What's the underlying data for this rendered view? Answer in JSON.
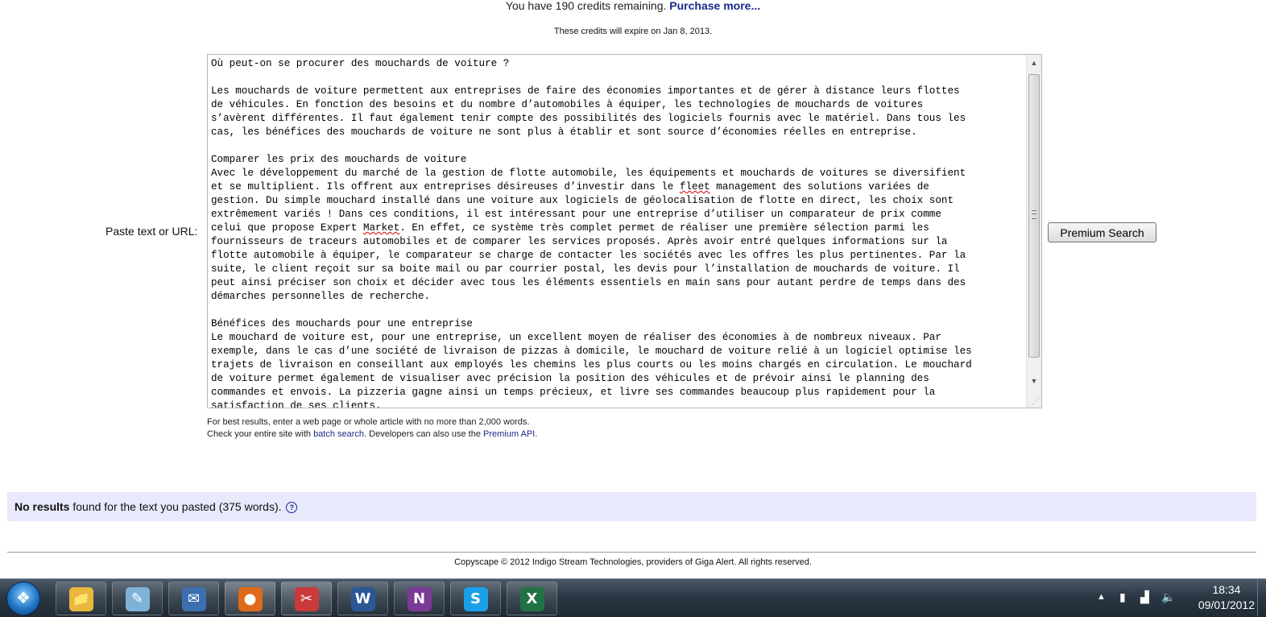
{
  "credits": {
    "prefix": "You have 190 credits remaining.",
    "purchase_link": "Purchase more...",
    "expiry": "These credits will expire on Jan 8, 2013."
  },
  "search": {
    "label": "Paste text or URL:",
    "button_label": "Premium Search",
    "text_lines": [
      "Où peut-on se procurer des mouchards de voiture ?",
      "",
      "Les mouchards de voiture permettent aux entreprises de faire des économies importantes et de gérer à distance leurs flottes",
      "de véhicules. En fonction des besoins et du nombre d’automobiles à équiper, les technologies de mouchards de voitures",
      "s’avèrent différentes. Il faut également tenir compte des possibilités des logiciels fournis avec le matériel. Dans tous les",
      "cas, les bénéfices des mouchards de voiture ne sont plus à établir et sont source d’économies réelles en entreprise.",
      "",
      "Comparer les prix des mouchards de voiture",
      "Avec le développement du marché de la gestion de flotte automobile, les équipements et mouchards de voitures se diversifient",
      "et se multiplient. Ils offrent aux entreprises désireuses d’investir dans le fleet management des solutions variées de",
      "gestion. Du simple mouchard installé dans une voiture aux logiciels de géolocalisation de flotte en direct, les choix sont",
      "extrêmement variés ! Dans ces conditions, il est intéressant pour une entreprise d’utiliser un comparateur de prix comme",
      "celui que propose Expert Market. En effet, ce système très complet permet de réaliser une première sélection parmi les",
      "fournisseurs de traceurs automobiles et de comparer les services proposés. Après avoir entré quelques informations sur la",
      "flotte automobile à équiper, le comparateur se charge de contacter les sociétés avec les offres les plus pertinentes. Par la",
      "suite, le client reçoit sur sa boite mail ou par courrier postal, les devis pour l’installation de mouchards de voiture. Il",
      "peut ainsi préciser son choix et décider avec tous les éléments essentiels en main sans pour autant perdre de temps dans des",
      "démarches personnelles de recherche.",
      "",
      "Bénéfices des mouchards pour une entreprise",
      "Le mouchard de voiture est, pour une entreprise, un excellent moyen de réaliser des économies à de nombreux niveaux. Par",
      "exemple, dans le cas d’une société de livraison de pizzas à domicile, le mouchard de voiture relié à un logiciel optimise les",
      "trajets de livraison en conseillant aux employés les chemins les plus courts ou les moins chargés en circulation. Le mouchard",
      "de voiture permet également de visualiser avec précision la position des véhicules et de prévoir ainsi le planning des",
      "commandes et envois. La pizzeria gagne ainsi un temps précieux, et livre ses commandes beaucoup plus rapidement pour la",
      "satisfaction de ses clients."
    ]
  },
  "hint": {
    "line1": "For best results, enter a web page or whole article with no more than 2,000 words.",
    "line2_a": "Check your entire site with ",
    "batch_link": "batch search",
    "line2_b": ". Developers can also use the ",
    "api_link": "Premium API",
    "line2_c": "."
  },
  "results": {
    "bold": "No results",
    "rest": " found for the text you pasted (375 words).",
    "help_icon": "?"
  },
  "footer": "Copyscape © 2012 Indigo Stream Technologies, providers of Giga Alert. All rights reserved.",
  "taskbar": {
    "apps": [
      {
        "name": "windows-explorer",
        "glyph": "📁",
        "color": "#e8b93c"
      },
      {
        "name": "notepad",
        "glyph": "✎",
        "color": "#7fb2d8"
      },
      {
        "name": "thunderbird",
        "glyph": "✉",
        "color": "#3d6fb0"
      },
      {
        "name": "firefox",
        "glyph": "●",
        "color": "#e06a1b"
      },
      {
        "name": "snipping-tool",
        "glyph": "✂",
        "color": "#c93a3a"
      },
      {
        "name": "word",
        "glyph": "W",
        "color": "#2b5797"
      },
      {
        "name": "onenote",
        "glyph": "N",
        "color": "#7b3a96"
      },
      {
        "name": "skype",
        "glyph": "S",
        "color": "#1aa0e8"
      },
      {
        "name": "excel",
        "glyph": "X",
        "color": "#217346"
      }
    ],
    "time": "18:34",
    "date": "09/01/2012"
  }
}
